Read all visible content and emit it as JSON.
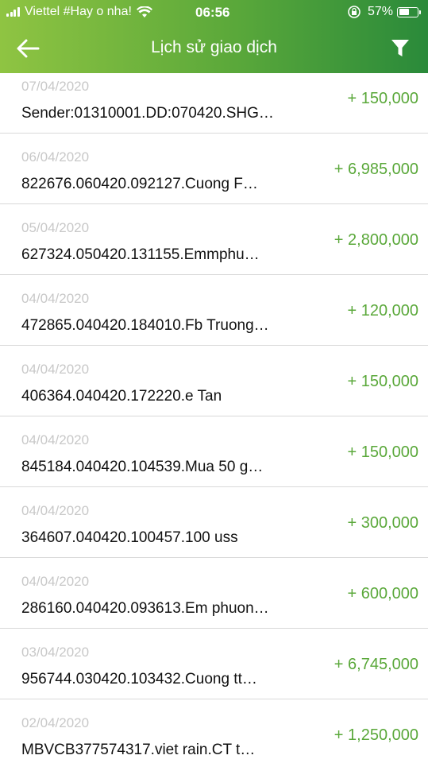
{
  "status_bar": {
    "carrier": "Viettel #Hay o nha!",
    "time": "06:56",
    "battery": "57%",
    "battery_level": 0.57
  },
  "header": {
    "title": "Lịch sử giao dịch",
    "back_icon": "arrow-left-icon",
    "filter_icon": "filter-icon"
  },
  "transactions": [
    {
      "date": "07/04/2020",
      "description": "Sender:01310001.DD:070420.SHG…",
      "amount": "+ 150,000"
    },
    {
      "date": "06/04/2020",
      "description": "822676.060420.092127.Cuong F…",
      "amount": "+ 6,985,000"
    },
    {
      "date": "05/04/2020",
      "description": "627324.050420.131155.Emmphu…",
      "amount": "+ 2,800,000"
    },
    {
      "date": "04/04/2020",
      "description": "472865.040420.184010.Fb Truong…",
      "amount": "+ 120,000"
    },
    {
      "date": "04/04/2020",
      "description": "406364.040420.172220.e Tan",
      "amount": "+ 150,000"
    },
    {
      "date": "04/04/2020",
      "description": "845184.040420.104539.Mua 50 g…",
      "amount": "+ 150,000"
    },
    {
      "date": "04/04/2020",
      "description": "364607.040420.100457.100 uss",
      "amount": "+ 300,000"
    },
    {
      "date": "04/04/2020",
      "description": "286160.040420.093613.Em phuon…",
      "amount": "+ 600,000"
    },
    {
      "date": "03/04/2020",
      "description": "956744.030420.103432.Cuong tt…",
      "amount": "+ 6,745,000"
    },
    {
      "date": "02/04/2020",
      "description": "MBVCB377574317.viet rain.CT t…",
      "amount": "+ 1,250,000"
    }
  ],
  "colors": {
    "header_start": "#8fc442",
    "header_end": "#2a8a3a",
    "amount": "#5aa83a",
    "date": "#c8c8c8"
  }
}
